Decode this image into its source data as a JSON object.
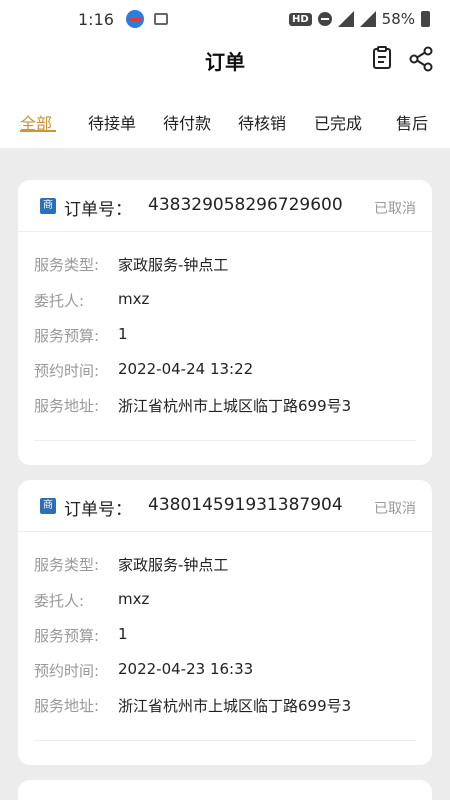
{
  "status_bar": {
    "time": "1:16",
    "hd": "HD",
    "battery": "58%"
  },
  "nav": {
    "title": "订单"
  },
  "tabs": [
    {
      "label": "全部",
      "active": true
    },
    {
      "label": "待接单",
      "active": false
    },
    {
      "label": "待付款",
      "active": false
    },
    {
      "label": "待核销",
      "active": false
    },
    {
      "label": "已完成",
      "active": false
    },
    {
      "label": "售后",
      "active": false
    }
  ],
  "shop_badge": "商",
  "order_label": "订单号：",
  "field_labels": {
    "service_type": "服务类型:",
    "client": "委托人:",
    "budget": "服务预算:",
    "time": "预约时间:",
    "address": "服务地址:"
  },
  "orders": [
    {
      "order_no": "438329058296729600",
      "status": "已取消",
      "service_type": "家政服务-钟点工",
      "client": "mxz",
      "budget": "1",
      "time": "2022-04-24 13:22",
      "address": "浙江省杭州市上城区临丁路699号3"
    },
    {
      "order_no": "438014591931387904",
      "status": "已取消",
      "service_type": "家政服务-钟点工",
      "client": "mxz",
      "budget": "1",
      "time": "2022-04-23 16:33",
      "address": "浙江省杭州市上城区临丁路699号3"
    }
  ],
  "colors": {
    "accent": "#c9963a",
    "background": "#ececec",
    "badge": "#2c6fb7"
  }
}
